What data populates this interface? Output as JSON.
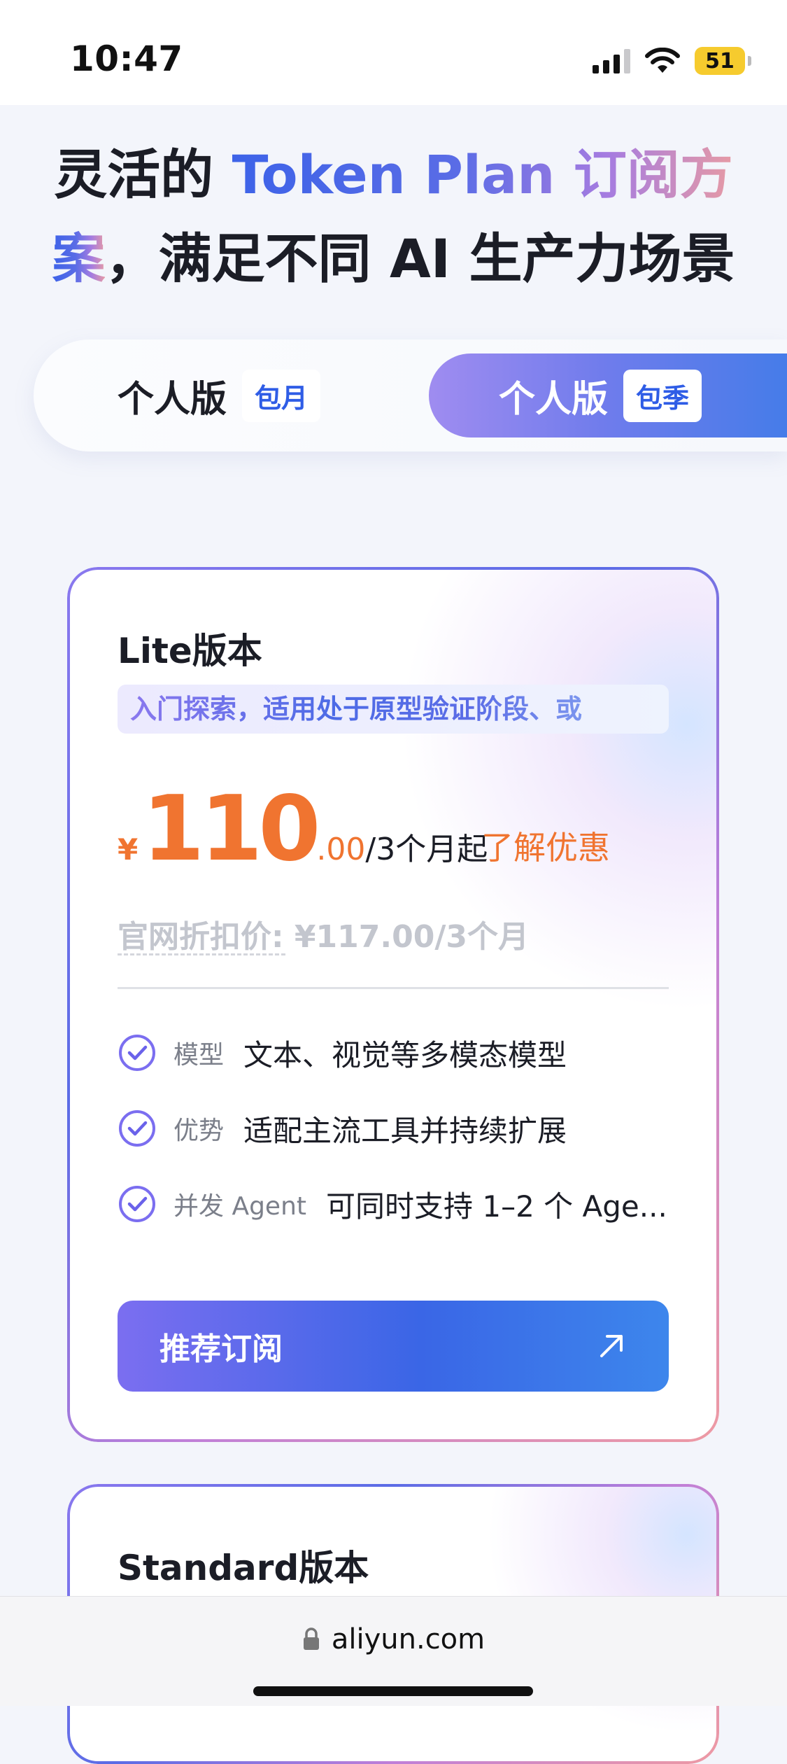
{
  "status_bar": {
    "time": "10:47",
    "battery": "51"
  },
  "hero": {
    "line1_prefix": "灵活的 ",
    "line1_highlight": "Token Plan 订阅方",
    "line2_highlight": "案",
    "line2_rest": "，满足不同 AI 生产力场景"
  },
  "tabs": [
    {
      "label": "个人版",
      "badge": "包月",
      "active": false
    },
    {
      "label": "个人版",
      "badge": "包季",
      "active": true
    }
  ],
  "plans": [
    {
      "title": "Lite版本",
      "description": "入门探索，适用处于原型验证阶段、或",
      "currency": "¥",
      "price_int": "110",
      "price_dec": ".00",
      "price_unit": "/3个月起",
      "promo_link": "了解优惠",
      "list_price": "官网折扣价: ¥117.00/3个月",
      "features": [
        {
          "label": "模型",
          "value": "文本、视觉等多模态模型"
        },
        {
          "label": "优势",
          "value": "适配主流工具并持续扩展"
        },
        {
          "label": "并发 Agent",
          "value": "可同时支持 1–2 个 Age..."
        }
      ],
      "cta_label": "推荐订阅"
    },
    {
      "title": "Standard版本"
    }
  ],
  "browser": {
    "url": "aliyun.com"
  },
  "colors": {
    "accent_orange": "#f07430",
    "accent_blue": "#3a66e6",
    "accent_purple": "#8a78ee"
  },
  "icons": {
    "check": "check-circle-icon",
    "arrow": "arrow-up-right-icon",
    "lock": "lock-icon"
  }
}
